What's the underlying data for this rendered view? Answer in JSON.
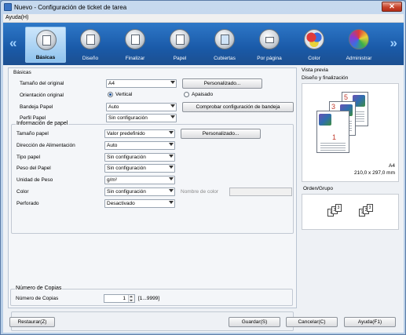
{
  "window": {
    "title": "Nuevo - Configuración de ticket de tarea",
    "close_label": "✕"
  },
  "menu": {
    "help": "Ayuda(H)"
  },
  "ribbon": {
    "prev_arrow": "«",
    "next_arrow": "»",
    "tabs": [
      {
        "label": "Básicas",
        "icon": "basic-settings-icon",
        "active": true
      },
      {
        "label": "Diseño",
        "icon": "layout-icon"
      },
      {
        "label": "Finalizar",
        "icon": "finishing-icon"
      },
      {
        "label": "Papel",
        "icon": "paper-icon"
      },
      {
        "label": "Cubiertas",
        "icon": "covers-icon"
      },
      {
        "label": "Por página",
        "icon": "per-page-icon"
      },
      {
        "label": "Color",
        "icon": "color-icon"
      },
      {
        "label": "Administrar",
        "icon": "admin-icon"
      }
    ]
  },
  "basicas": {
    "legend": "Básicas",
    "original_size_label": "Tamaño del original",
    "original_size_value": "A4",
    "custom_button": "Personalizado...",
    "orientation_label": "Orientación original",
    "orientation_vertical": "Vertical",
    "orientation_landscape": "Apaisado",
    "tray_label": "Bandeja Papel",
    "tray_value": "Auto",
    "check_tray_button": "Comprobar configuración de bandeja",
    "paper_profile_label": "Perfil Papel",
    "paper_profile_value": "Sin configuración"
  },
  "paper_info": {
    "legend": "Información de papel",
    "size_label": "Tamaño papel",
    "size_value": "Valor predefinido",
    "custom_button": "Personalizado...",
    "feed_label": "Dirección de Alimentación",
    "feed_value": "Auto",
    "type_label": "Tipo papel",
    "type_value": "Sin configuración",
    "weight_label": "Peso del Papel",
    "weight_value": "Sin configuración",
    "weight_unit_label": "Unidad de Peso",
    "weight_unit_value": "g/m²",
    "color_label": "Color",
    "color_value": "Sin configuración",
    "color_name_label": "Nombre de color",
    "punched_label": "Perforado",
    "punched_value": "Desactivado"
  },
  "copies": {
    "legend": "Número de Copias",
    "label": "Número de Copias",
    "value": "1",
    "range": "[1...9999]"
  },
  "preview": {
    "title": "Vista previa",
    "layout_label": "Diseño y finalización",
    "page_numbers": [
      "5",
      "3",
      "1"
    ],
    "paper_name": "A4",
    "paper_dims": "210,0 x 297,0 mm",
    "order_label": "Orden/Grupo",
    "group1": [
      "1",
      "2",
      "3"
    ],
    "group2": [
      "1",
      "2",
      "3"
    ]
  },
  "footer": {
    "reset": "Restaurar(Z)",
    "save": "Guardar(S)",
    "cancel": "Cancelar(C)",
    "help": "Ayuda(F1)"
  }
}
